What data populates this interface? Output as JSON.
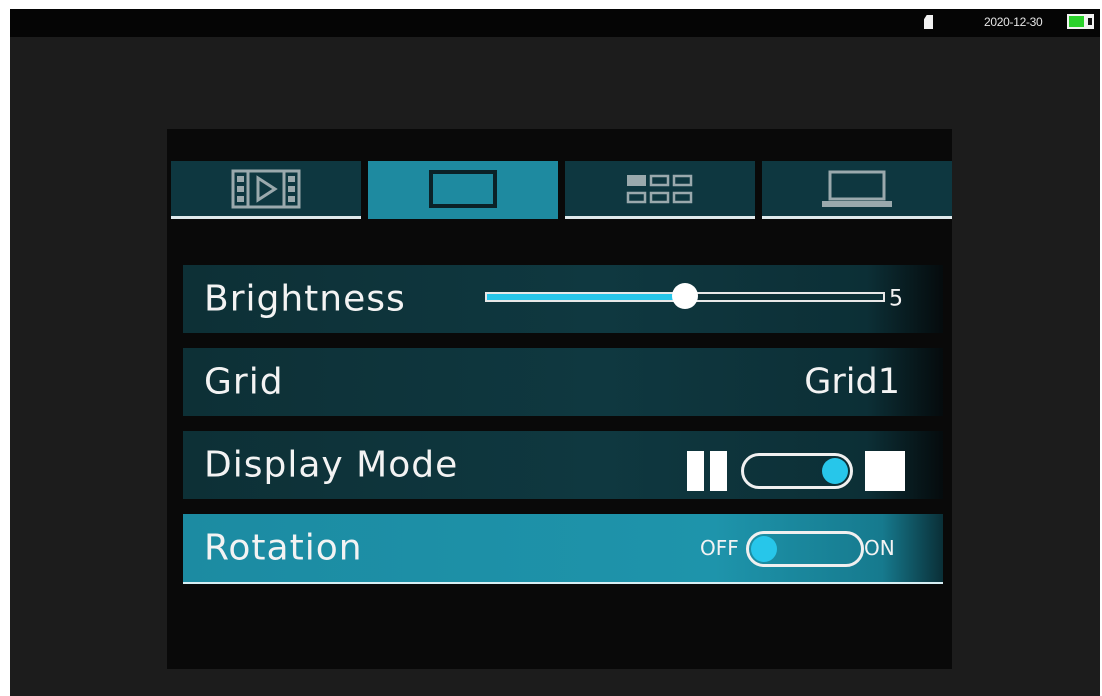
{
  "status": {
    "date": "2020-12-30",
    "battery_level": 0.8,
    "battery_color": "#2bd12b"
  },
  "tabs": [
    {
      "icon": "video-playback-icon",
      "active": false
    },
    {
      "icon": "display-icon",
      "active": true
    },
    {
      "icon": "grid-layout-icon",
      "active": false
    },
    {
      "icon": "laptop-icon",
      "active": false
    }
  ],
  "settings": {
    "brightness": {
      "label": "Brightness",
      "value": "5",
      "level": 0.5
    },
    "grid": {
      "label": "Grid",
      "value": "Grid1"
    },
    "display_mode": {
      "label": "Display Mode",
      "toggle_on": true
    },
    "rotation": {
      "label": "Rotation",
      "off_label": "OFF",
      "on_label": "ON",
      "toggle_on": false
    }
  },
  "colors": {
    "accent": "#27c6ea",
    "selected_row": "#1e8aa0",
    "row_bg": "#0f3840"
  }
}
